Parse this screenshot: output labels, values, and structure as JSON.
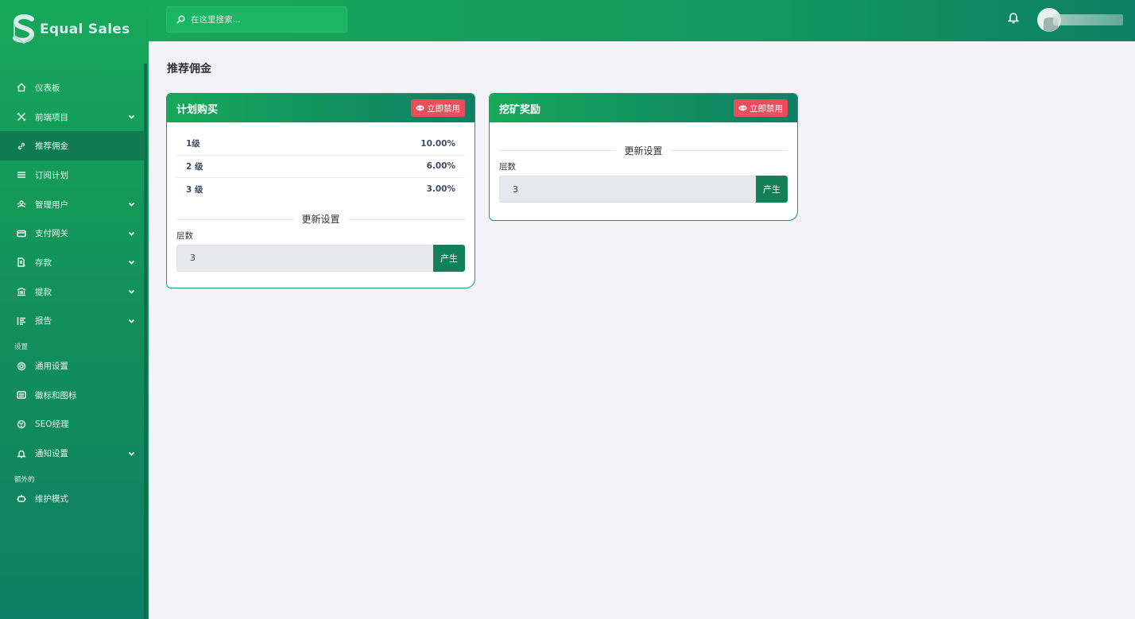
{
  "brand": {
    "name": "Equal Sales"
  },
  "search": {
    "placeholder": "在这里搜索..."
  },
  "sidebar": {
    "items": [
      {
        "label": "仪表板",
        "icon": "home-icon",
        "has_submenu": false,
        "active": false
      },
      {
        "label": "前端项目",
        "icon": "tools-icon",
        "has_submenu": true,
        "active": false
      },
      {
        "label": "推荐佣金",
        "icon": "link-icon",
        "has_submenu": false,
        "active": true
      },
      {
        "label": "订阅计划",
        "icon": "list-icon",
        "has_submenu": false,
        "active": false
      },
      {
        "label": "管理用户",
        "icon": "users-icon",
        "has_submenu": true,
        "active": false
      },
      {
        "label": "支付网关",
        "icon": "card-icon",
        "has_submenu": true,
        "active": false
      },
      {
        "label": "存款",
        "icon": "deposit-icon",
        "has_submenu": true,
        "active": false
      },
      {
        "label": "提款",
        "icon": "bank-icon",
        "has_submenu": true,
        "active": false
      },
      {
        "label": "报告",
        "icon": "report-icon",
        "has_submenu": true,
        "active": false
      }
    ],
    "section_settings": "设置",
    "settings_items": [
      {
        "label": "通用设置",
        "icon": "gear-icon",
        "has_submenu": false
      },
      {
        "label": "徽标和图标",
        "icon": "image-icon",
        "has_submenu": false
      },
      {
        "label": "SEO经理",
        "icon": "globe-icon",
        "has_submenu": false
      },
      {
        "label": "通知设置",
        "icon": "bell-icon",
        "has_submenu": true
      }
    ],
    "section_extra": "额外的",
    "extra_items": [
      {
        "label": "维护模式",
        "icon": "robot-icon",
        "has_submenu": false
      }
    ]
  },
  "page": {
    "title": "推荐佣金"
  },
  "cards": [
    {
      "title": "计划购买",
      "disable_label": "立即禁用",
      "levels": [
        {
          "level": "1级",
          "percent": "10.00%"
        },
        {
          "level": "2 级",
          "percent": "6.00%"
        },
        {
          "level": "3 级",
          "percent": "3.00%"
        }
      ],
      "update_label": "更新设置",
      "field_label": "层数",
      "field_value": "3",
      "generate_label": "产生"
    },
    {
      "title": "挖矿奖励",
      "disable_label": "立即禁用",
      "update_label": "更新设置",
      "field_label": "层数",
      "field_value": "3",
      "generate_label": "产生"
    }
  ],
  "colors": {
    "primary_green": "#17a85a",
    "dark_green": "#0e7f64",
    "danger": "#ea4e5c"
  }
}
